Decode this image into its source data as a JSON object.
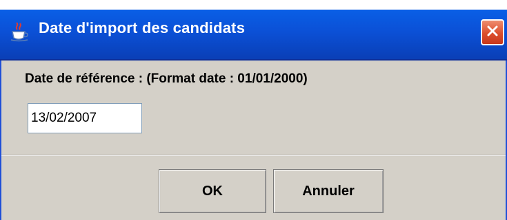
{
  "window": {
    "title": "Date d'import des candidats",
    "icons": {
      "app": "java-cup-icon",
      "close": "close-icon"
    },
    "colors": {
      "titlebar": "#0b50d6",
      "background": "#d4d0c8",
      "close_button": "#dc4e2c"
    }
  },
  "form": {
    "reference_label": "Date de référence : (Format date : 01/01/2000)",
    "date_value": "13/02/2007"
  },
  "buttons": {
    "ok_label": "OK",
    "cancel_label": "Annuler"
  }
}
